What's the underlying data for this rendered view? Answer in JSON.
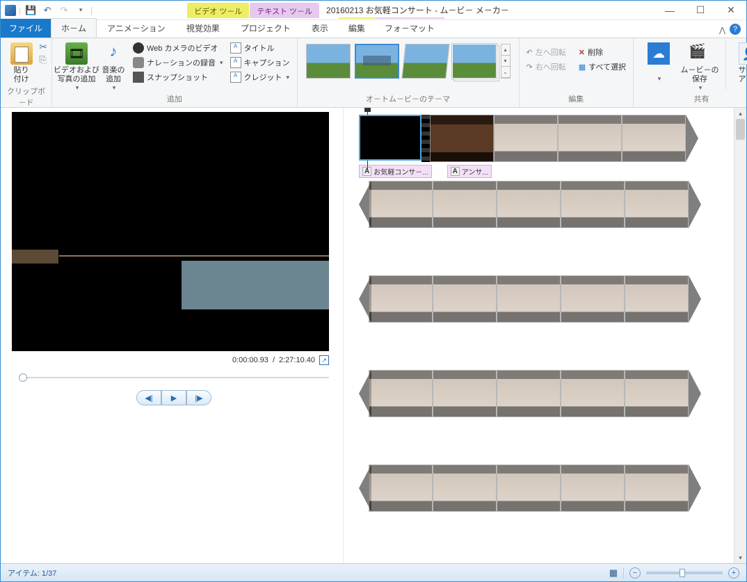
{
  "title": "20160213 お気軽コンサート - ム－ビ－ メ－カ－",
  "tool_tabs": {
    "video": "ビデオ ツ－ル",
    "text": "テキスト ツ－ル"
  },
  "sub_tabs": {
    "video": "編集",
    "text": "フォ－マット"
  },
  "tabs": {
    "file": "ファイル",
    "home": "ホ－ム",
    "anim": "アニメ－ション",
    "vfx": "視覚効果",
    "project": "プロジェクト",
    "view": "表示"
  },
  "ribbon": {
    "clipboard": {
      "label": "クリップボ－ド",
      "paste": "貼り\n付け",
      "cut": "切り取り"
    },
    "add": {
      "label": "追加",
      "addvideo": "ビデオおよび\n写真の追加",
      "addmusic": "音楽の\n追加",
      "webcam": "Web カメラのビデオ",
      "narration": "ナレ－ションの録音",
      "snapshot": "スナップショット",
      "title": "タイトル",
      "caption": "キャプション",
      "credits": "クレジット"
    },
    "themes": {
      "label": "オ－トム－ビ－のテ－マ"
    },
    "edit": {
      "label": "編集",
      "rotleft": "左へ回転",
      "rotright": "右へ回転",
      "delete": "削除",
      "selectall": "すべて選択"
    },
    "share": {
      "label": "共有",
      "save": "ム－ビ－の\n保存",
      "signout": "サイン\nアウト"
    }
  },
  "preview": {
    "time_current": "0:00:00.93",
    "time_total": "2:27:10.40"
  },
  "captions": {
    "c1": "お気軽コンサ－...",
    "c2": "アンサ..."
  },
  "status": {
    "items": "アイテム: 1/37"
  }
}
